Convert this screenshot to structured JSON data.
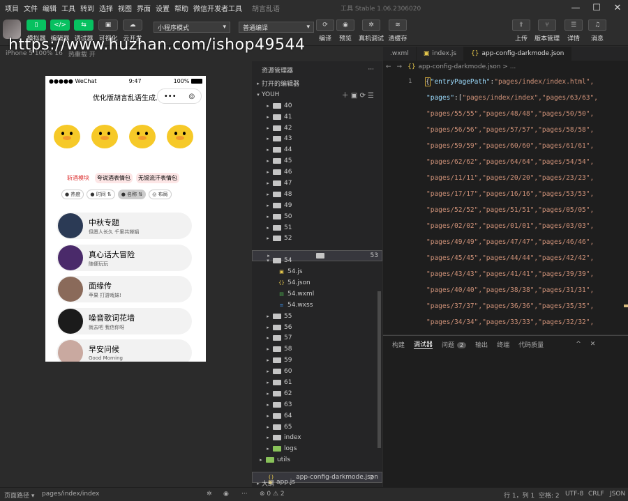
{
  "menu": [
    "项目",
    "文件",
    "编辑",
    "工具",
    "转到",
    "选择",
    "视图",
    "界面",
    "设置",
    "帮助",
    "微信开发者工具"
  ],
  "project_name": "胡言乱语",
  "app_title": "工具 Stable 1.06.2306020",
  "window_controls": [
    "—",
    "☐",
    "✕"
  ],
  "toolbar": {
    "left_buttons": [
      {
        "label": "模拟器",
        "glyph": "▯"
      },
      {
        "label": "编辑器",
        "glyph": "</>"
      },
      {
        "label": "调试器",
        "glyph": "⇆"
      },
      {
        "label": "可视化",
        "glyph": "▣"
      },
      {
        "label": "云开发",
        "glyph": "☁"
      }
    ],
    "mode_select": "小程序模式",
    "compile_select": "普通编译",
    "mid_buttons": [
      "编译",
      "预览",
      "真机调试",
      "清缓存"
    ],
    "right_buttons": [
      "上传",
      "版本管理",
      "详情",
      "消息"
    ]
  },
  "simulator": {
    "device": "iPhone 5 100% 16",
    "hotreload": "热重载 开",
    "status_left": "●●●●● WeChat",
    "status_time": "9:47",
    "status_battery": "100%",
    "nav_title": "优化版胡言乱语生成...",
    "capsule_more": "•••",
    "capsule_close": "◎",
    "tags": [
      "斩酒模块",
      "夸说酒表情包",
      "无锡流汗表情包"
    ],
    "filters": [
      "热度",
      "时间",
      "名称",
      "布局"
    ],
    "items": [
      {
        "title": "中秋专题",
        "subtitle": "但愿人长久 千里共婵娟",
        "color": "#2b3a55"
      },
      {
        "title": "真心话大冒险",
        "subtitle": "随便玩玩",
        "color": "#4a2a6a"
      },
      {
        "title": "面缘传",
        "subtitle": "苹果 打游戏妹!",
        "color": "#8a6a5a"
      },
      {
        "title": "噪音歌词花墙",
        "subtitle": "就去吧 我信你呀",
        "color": "#1b1b1b"
      },
      {
        "title": "早安问候",
        "subtitle": "Good Morning",
        "color": "#c9a9a0"
      }
    ]
  },
  "explorer": {
    "title": "资源管理器",
    "more": "···",
    "open_editors": "打开的编辑器",
    "root": "YOUH",
    "folders_before": [
      "40",
      "41",
      "42",
      "43",
      "44",
      "45",
      "46",
      "47",
      "48",
      "49",
      "50",
      "51",
      "52",
      "53"
    ],
    "open_folder": "54",
    "open_files": [
      "54.js",
      "54.json",
      "54.wxml",
      "54.wxss"
    ],
    "folders_after": [
      "55",
      "56",
      "57",
      "58",
      "59",
      "60",
      "61",
      "62",
      "63",
      "64",
      "65",
      "index",
      "logs"
    ],
    "utils": "utils",
    "selected_file": "app-config-darkmode.json",
    "selected_badge": "2",
    "app_js": "app.js",
    "outline": "大纲"
  },
  "editor": {
    "tabs": [
      ".wxml",
      "index.js",
      "app-config-darkmode.json"
    ],
    "breadcrumb": "app-config-darkmode.json > ...",
    "line_number": "1",
    "first_line_key": "\"entryPagePath\"",
    "first_line_val": "\"pages/index/index.html\",",
    "pages_key": "\"pages\"",
    "code_lines": [
      "\"pages/index/index\",\"pages/63/63\",",
      "\"pages/55/55\",\"pages/48/48\",\"pages/50/50\",",
      "\"pages/56/56\",\"pages/57/57\",\"pages/58/58\",",
      "\"pages/59/59\",\"pages/60/60\",\"pages/61/61\",",
      "\"pages/62/62\",\"pages/64/64\",\"pages/54/54\",",
      "\"pages/11/11\",\"pages/20/20\",\"pages/23/23\",",
      "\"pages/17/17\",\"pages/16/16\",\"pages/53/53\",",
      "\"pages/52/52\",\"pages/51/51\",\"pages/05/05\",",
      "\"pages/02/02\",\"pages/01/01\",\"pages/03/03\",",
      "\"pages/49/49\",\"pages/47/47\",\"pages/46/46\",",
      "\"pages/45/45\",\"pages/44/44\",\"pages/42/42\",",
      "\"pages/43/43\",\"pages/41/41\",\"pages/39/39\",",
      "\"pages/40/40\",\"pages/38/38\",\"pages/31/31\",",
      "\"pages/37/37\",\"pages/36/36\",\"pages/35/35\",",
      "\"pages/34/34\",\"pages/33/33\",\"pages/32/32\","
    ]
  },
  "debug": {
    "tabs": [
      "构建",
      "调试器",
      "问题",
      "输出",
      "终端",
      "代码质量"
    ],
    "problems_count": "2",
    "controls": [
      "^",
      "✕"
    ]
  },
  "statusbar": {
    "page_path_label": "页面路径 ▾",
    "page_path": "pages/index/index",
    "errors": "⊗ 0 ⚠ 2",
    "position": "行 1，列 1",
    "spaces": "空格: 2",
    "encoding": "UTF-8",
    "eol": "CRLF",
    "lang": "JSON"
  },
  "watermark": "https://www.huzhan.com/ishop49544"
}
